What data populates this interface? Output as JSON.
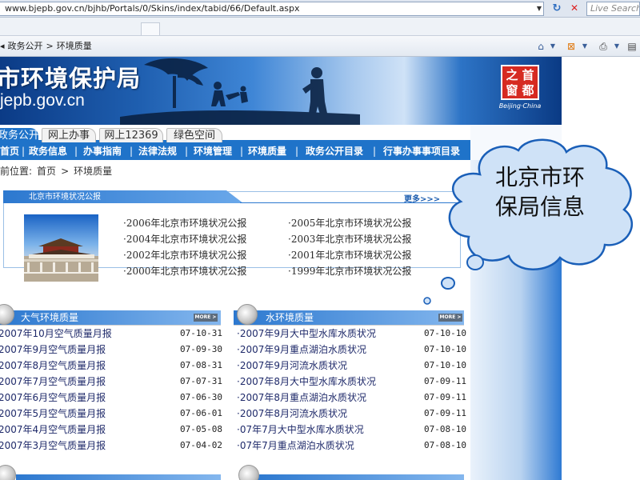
{
  "browser": {
    "url": "www.bjepb.gov.cn/bjhb/Portals/0/Skins/index/tabid/66/Default.aspx",
    "search_placeholder": "Live Search",
    "tab_breadcrumb": [
      "政务公开",
      ">",
      "环境质量"
    ]
  },
  "banner": {
    "title": "市环境保护局",
    "domain": "jepb.gov.cn",
    "seal_chars": [
      "首",
      "都",
      "之",
      "窗"
    ],
    "seal_caption": "Beijing·China"
  },
  "tabs": [
    {
      "label": "政务公开",
      "active": true
    },
    {
      "label": "网上办事",
      "active": false
    },
    {
      "label": "网上12369",
      "active": false
    },
    {
      "label": "绿色空间",
      "active": false
    }
  ],
  "nav": [
    "首页",
    "政务信息",
    "办事指南",
    "法律法规",
    "环境管理",
    "环境质量",
    "政务公开目录",
    "行事办事事项目录"
  ],
  "location": {
    "prefix": "前位置:",
    "home": "首页",
    "separator": ">",
    "current": "环境质量"
  },
  "report_panel": {
    "title": "北京市环境状况公报",
    "more": "更多>>>",
    "links_left": [
      "·2006年北京市环境状况公报",
      "·2004年北京市环境状况公报",
      "·2002年北京市环境状况公报",
      "·2000年北京市环境状况公报"
    ],
    "links_right": [
      "·2005年北京市环境状况公报",
      "·2003年北京市环境状况公报",
      "·2001年北京市环境状况公报",
      "·1999年北京市环境状况公报"
    ]
  },
  "air_panel": {
    "title": "大气环境质量",
    "more": "MORE >",
    "rows": [
      {
        "title": "2007年10月空气质量月报",
        "date": "07-10-31"
      },
      {
        "title": "2007年9月空气质量月报",
        "date": "07-09-30"
      },
      {
        "title": "2007年8月空气质量月报",
        "date": "07-08-31"
      },
      {
        "title": "2007年7月空气质量月报",
        "date": "07-07-31"
      },
      {
        "title": "2007年6月空气质量月报",
        "date": "07-06-30"
      },
      {
        "title": "2007年5月空气质量月报",
        "date": "07-06-01"
      },
      {
        "title": "2007年4月空气质量月报",
        "date": "07-05-08"
      },
      {
        "title": "2007年3月空气质量月报",
        "date": "07-04-02"
      }
    ]
  },
  "water_panel": {
    "title": "水环境质量",
    "more": "MORE >",
    "rows": [
      {
        "title": "·2007年9月大中型水库水质状况",
        "date": "07-10-10"
      },
      {
        "title": "·2007年9月重点湖泊水质状况",
        "date": "07-10-10"
      },
      {
        "title": "·2007年9月河流水质状况",
        "date": "07-10-10"
      },
      {
        "title": "·2007年8月大中型水库水质状况",
        "date": "07-09-11"
      },
      {
        "title": "·2007年8月重点湖泊水质状况",
        "date": "07-09-11"
      },
      {
        "title": "·2007年8月河流水质状况",
        "date": "07-09-11"
      },
      {
        "title": "·07年7月大中型水库水质状况",
        "date": "07-08-10"
      },
      {
        "title": "·07年7月重点湖泊水质状况",
        "date": "07-08-10"
      }
    ]
  },
  "callout": {
    "line1": "北京市环",
    "line2": "保局信息"
  },
  "colors": {
    "nav_blue": "#1f73c9",
    "banner_dark": "#0b3b86",
    "seal_red": "#d62a21",
    "link_dark_blue": "#1f2a6a"
  }
}
